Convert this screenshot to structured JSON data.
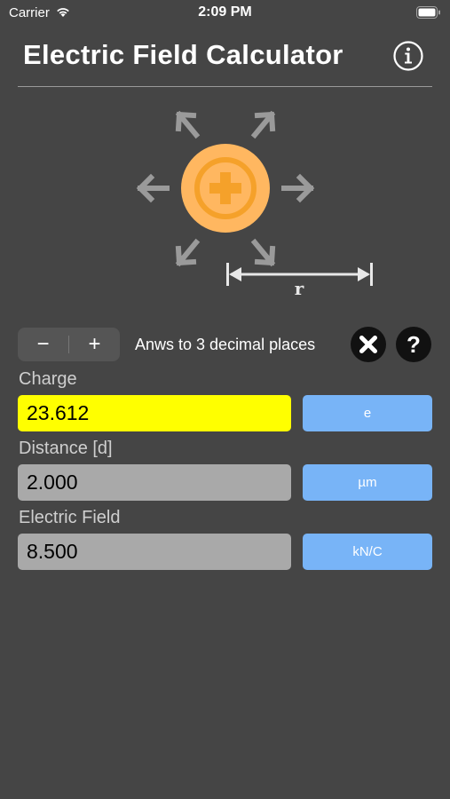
{
  "status": {
    "carrier": "Carrier",
    "time": "2:09 PM"
  },
  "header": {
    "title": "Electric Field Calculator",
    "info_icon": "info-icon"
  },
  "diagram": {
    "charge_symbol": "plus",
    "distance_label": "r",
    "charge_color": "#ffb760"
  },
  "controls": {
    "minus_label": "−",
    "plus_label": "+",
    "decimals_text": "Anws to 3 decimal places",
    "clear_icon": "close-icon",
    "help_label": "?"
  },
  "fields": [
    {
      "label": "Charge",
      "value": "23.612",
      "unit": "e",
      "active": true
    },
    {
      "label": "Distance [d]",
      "value": "2.000",
      "unit": "µm",
      "active": false
    },
    {
      "label": "Electric Field",
      "value": "8.500",
      "unit": "kN/C",
      "active": false
    }
  ],
  "colors": {
    "background": "#454545",
    "active_field": "#ffff00",
    "inactive_field": "#a9a9a9",
    "unit_button": "#78b4f7"
  }
}
